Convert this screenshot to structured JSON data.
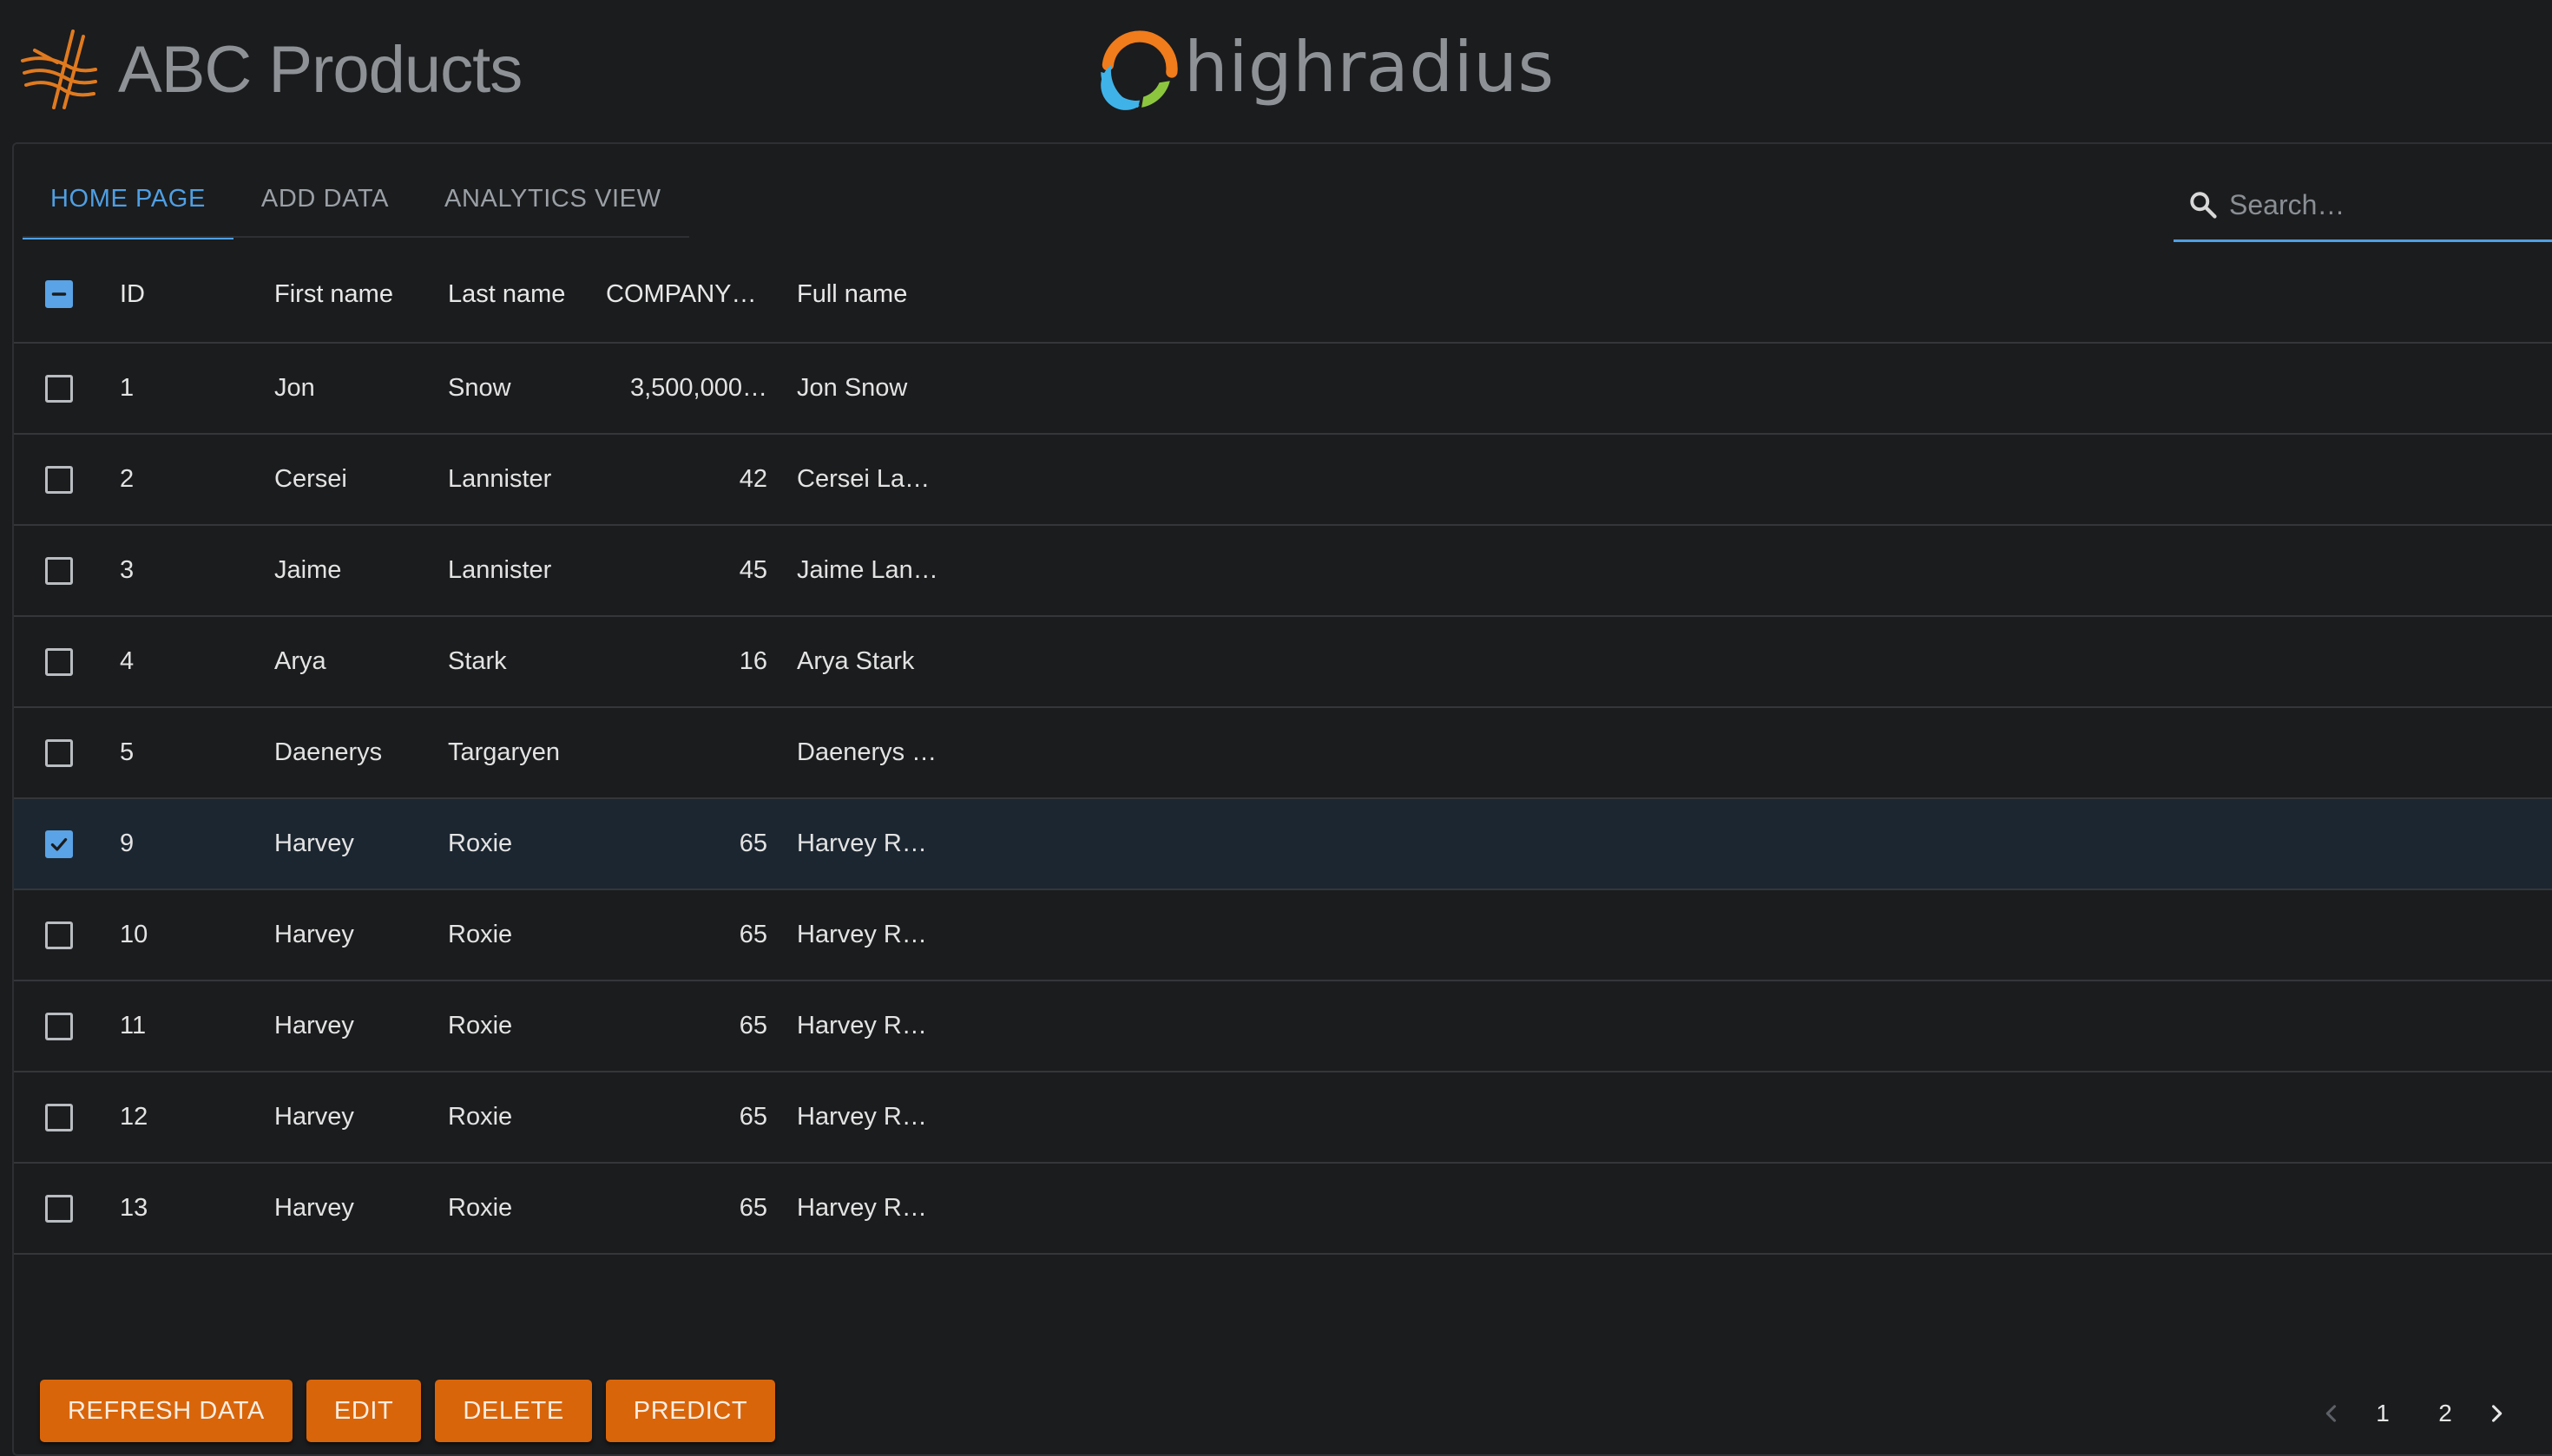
{
  "header": {
    "app_title": "ABC Products",
    "partner_logo_text": "highradius"
  },
  "tabs": [
    {
      "label": "HOME PAGE",
      "active": true
    },
    {
      "label": "ADD DATA",
      "active": false
    },
    {
      "label": "ANALYTICS VIEW",
      "active": false
    }
  ],
  "search": {
    "placeholder": "Search…",
    "value": ""
  },
  "table": {
    "select_all_state": "indeterminate",
    "columns": [
      "ID",
      "First name",
      "Last name",
      "COMPANY…",
      "Full name"
    ],
    "rows": [
      {
        "checked": false,
        "id": "1",
        "first": "Jon",
        "last": "Snow",
        "company": "3,500,000…",
        "full": "Jon Snow"
      },
      {
        "checked": false,
        "id": "2",
        "first": "Cersei",
        "last": "Lannister",
        "company": "42",
        "full": "Cersei La…"
      },
      {
        "checked": false,
        "id": "3",
        "first": "Jaime",
        "last": "Lannister",
        "company": "45",
        "full": "Jaime Lan…"
      },
      {
        "checked": false,
        "id": "4",
        "first": "Arya",
        "last": "Stark",
        "company": "16",
        "full": "Arya Stark"
      },
      {
        "checked": false,
        "id": "5",
        "first": "Daenerys",
        "last": "Targaryen",
        "company": "",
        "full": "Daenerys …"
      },
      {
        "checked": true,
        "id": "9",
        "first": "Harvey",
        "last": "Roxie",
        "company": "65",
        "full": "Harvey R…"
      },
      {
        "checked": false,
        "id": "10",
        "first": "Harvey",
        "last": "Roxie",
        "company": "65",
        "full": "Harvey R…"
      },
      {
        "checked": false,
        "id": "11",
        "first": "Harvey",
        "last": "Roxie",
        "company": "65",
        "full": "Harvey R…"
      },
      {
        "checked": false,
        "id": "12",
        "first": "Harvey",
        "last": "Roxie",
        "company": "65",
        "full": "Harvey R…"
      },
      {
        "checked": false,
        "id": "13",
        "first": "Harvey",
        "last": "Roxie",
        "company": "65",
        "full": "Harvey R…"
      }
    ]
  },
  "actions": {
    "refresh_label": "REFRESH DATA",
    "edit_label": "EDIT",
    "delete_label": "DELETE",
    "predict_label": "PREDICT"
  },
  "pagination": {
    "pages": [
      "1",
      "2"
    ],
    "prev_icon": "chevron-left-icon",
    "next_icon": "chevron-right-icon"
  },
  "colors": {
    "accent_blue": "#4f9fe3",
    "button_orange": "#d9650b",
    "background": "#1b1c1e",
    "logo_orange": "#f07c1b",
    "logo_blue": "#3fb3e8",
    "logo_green": "#8cc63f"
  },
  "icons": {
    "brand": "abc-products-logo-icon",
    "partner": "highradius-logo-icon",
    "search": "search-icon",
    "checkbox_checked": "checkmark-icon",
    "checkbox_indeterminate": "minus-icon"
  }
}
